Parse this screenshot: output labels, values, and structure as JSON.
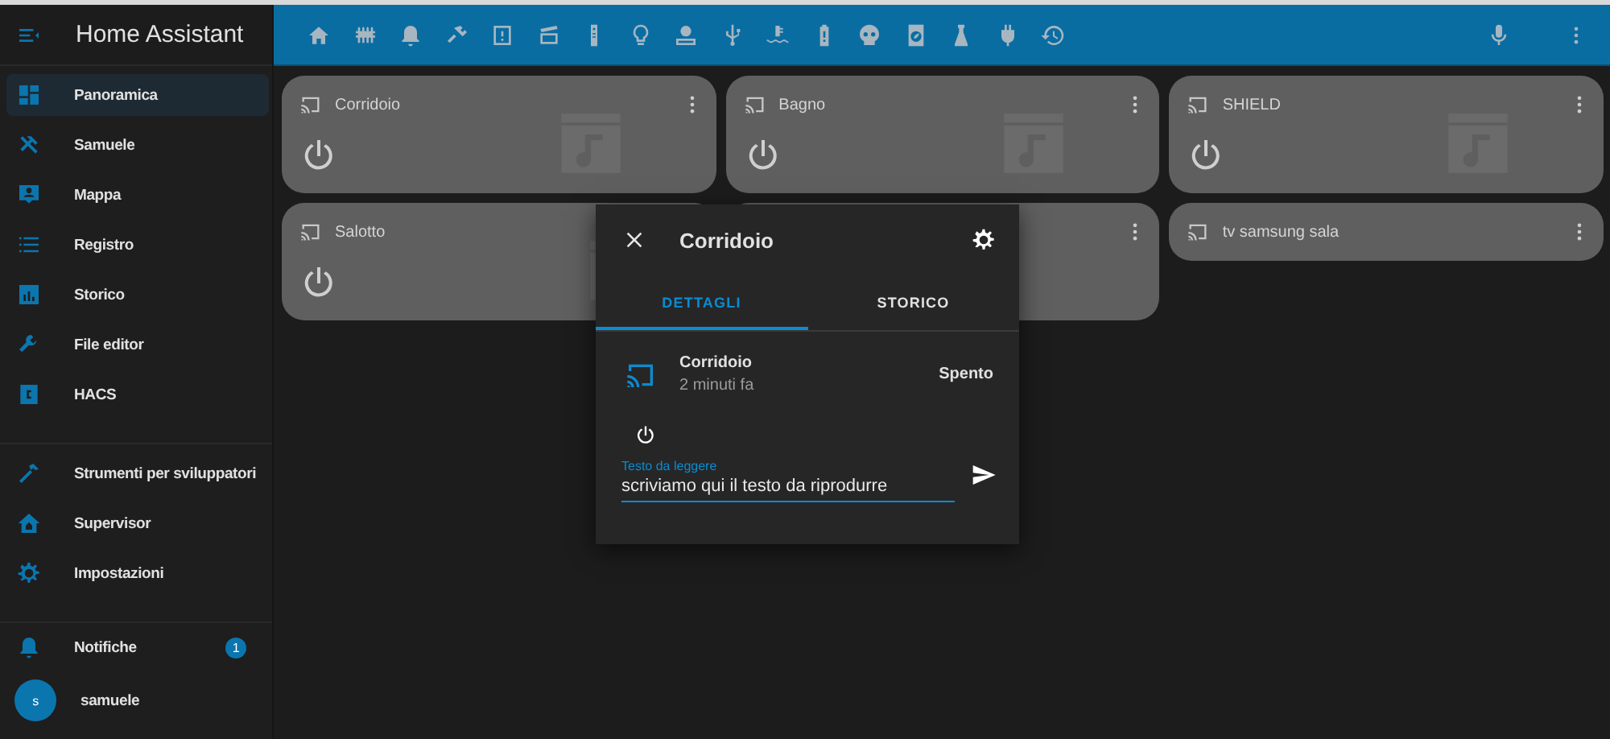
{
  "sidebar": {
    "title": "Home Assistant",
    "sections": [
      {
        "items": [
          {
            "label": "Panoramica",
            "selected": true
          },
          {
            "label": "Samuele",
            "selected": false
          },
          {
            "label": "Mappa",
            "selected": false
          },
          {
            "label": "Registro",
            "selected": false
          },
          {
            "label": "Storico",
            "selected": false
          },
          {
            "label": "File editor",
            "selected": false
          },
          {
            "label": "HACS",
            "selected": false
          }
        ]
      },
      {
        "items": [
          {
            "label": "Strumenti per sviluppatori",
            "selected": false
          },
          {
            "label": "Supervisor",
            "selected": false
          },
          {
            "label": "Impostazioni",
            "selected": false
          }
        ]
      }
    ],
    "notifications": {
      "label": "Notifiche",
      "badge": "1"
    },
    "user": {
      "initial": "s",
      "name": "samuele"
    }
  },
  "cards": [
    {
      "kind": "player",
      "name": "Corridoio"
    },
    {
      "kind": "player",
      "name": "Bagno"
    },
    {
      "kind": "player",
      "name": "SHIELD"
    },
    {
      "kind": "player",
      "name": "Salotto"
    },
    {
      "kind": "player"
    },
    {
      "kind": "compact",
      "name": "tv samsung sala"
    }
  ],
  "dialog": {
    "title": "Corridoio",
    "tabs": [
      {
        "label": "DETTAGLI",
        "selected": true
      },
      {
        "label": "STORICO",
        "selected": false
      }
    ],
    "entity": {
      "name": "Corridoio",
      "time": "2 minuti fa",
      "state": "Spento"
    },
    "field": {
      "label": "Testo da leggere",
      "value": "scriviamo qui il testo da riprodurre"
    }
  }
}
